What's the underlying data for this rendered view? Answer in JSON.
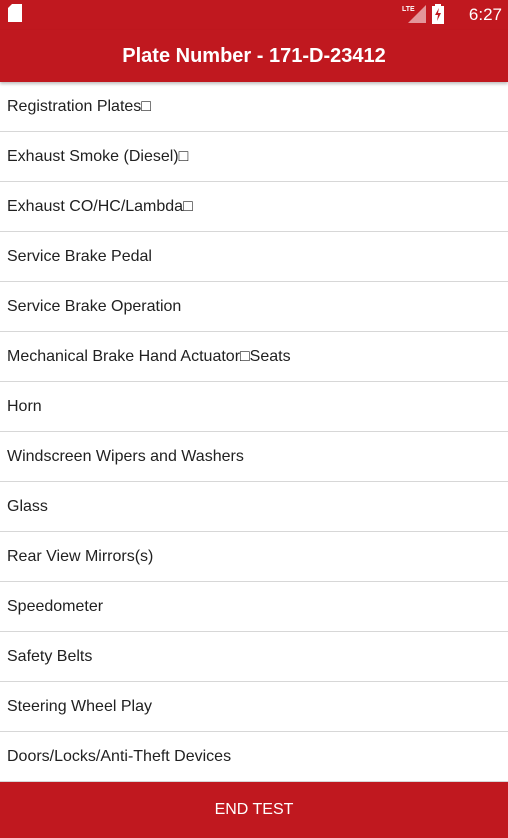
{
  "status_bar": {
    "network_label": "LTE",
    "time": "6:27",
    "icons": [
      "sd-card-icon",
      "lte-signal-icon",
      "battery-charging-icon"
    ]
  },
  "header": {
    "title": "Plate Number - 171-D-23412"
  },
  "checklist": {
    "items": [
      "Registration Plates□",
      "Exhaust Smoke (Diesel)□",
      "Exhaust CO/HC/Lambda□",
      "Service Brake Pedal",
      "Service Brake Operation",
      "Mechanical Brake Hand Actuator□Seats",
      "Horn",
      "Windscreen Wipers and Washers",
      "Glass",
      "Rear View Mirrors(s)",
      "Speedometer",
      "Safety Belts",
      "Steering Wheel Play",
      "Doors/Locks/Anti-Theft Devices"
    ]
  },
  "footer": {
    "end_test_label": "END TEST"
  },
  "colors": {
    "primary": "#c0181f",
    "divider": "#d7d7d7",
    "text": "#212121",
    "background": "#ffffff"
  }
}
